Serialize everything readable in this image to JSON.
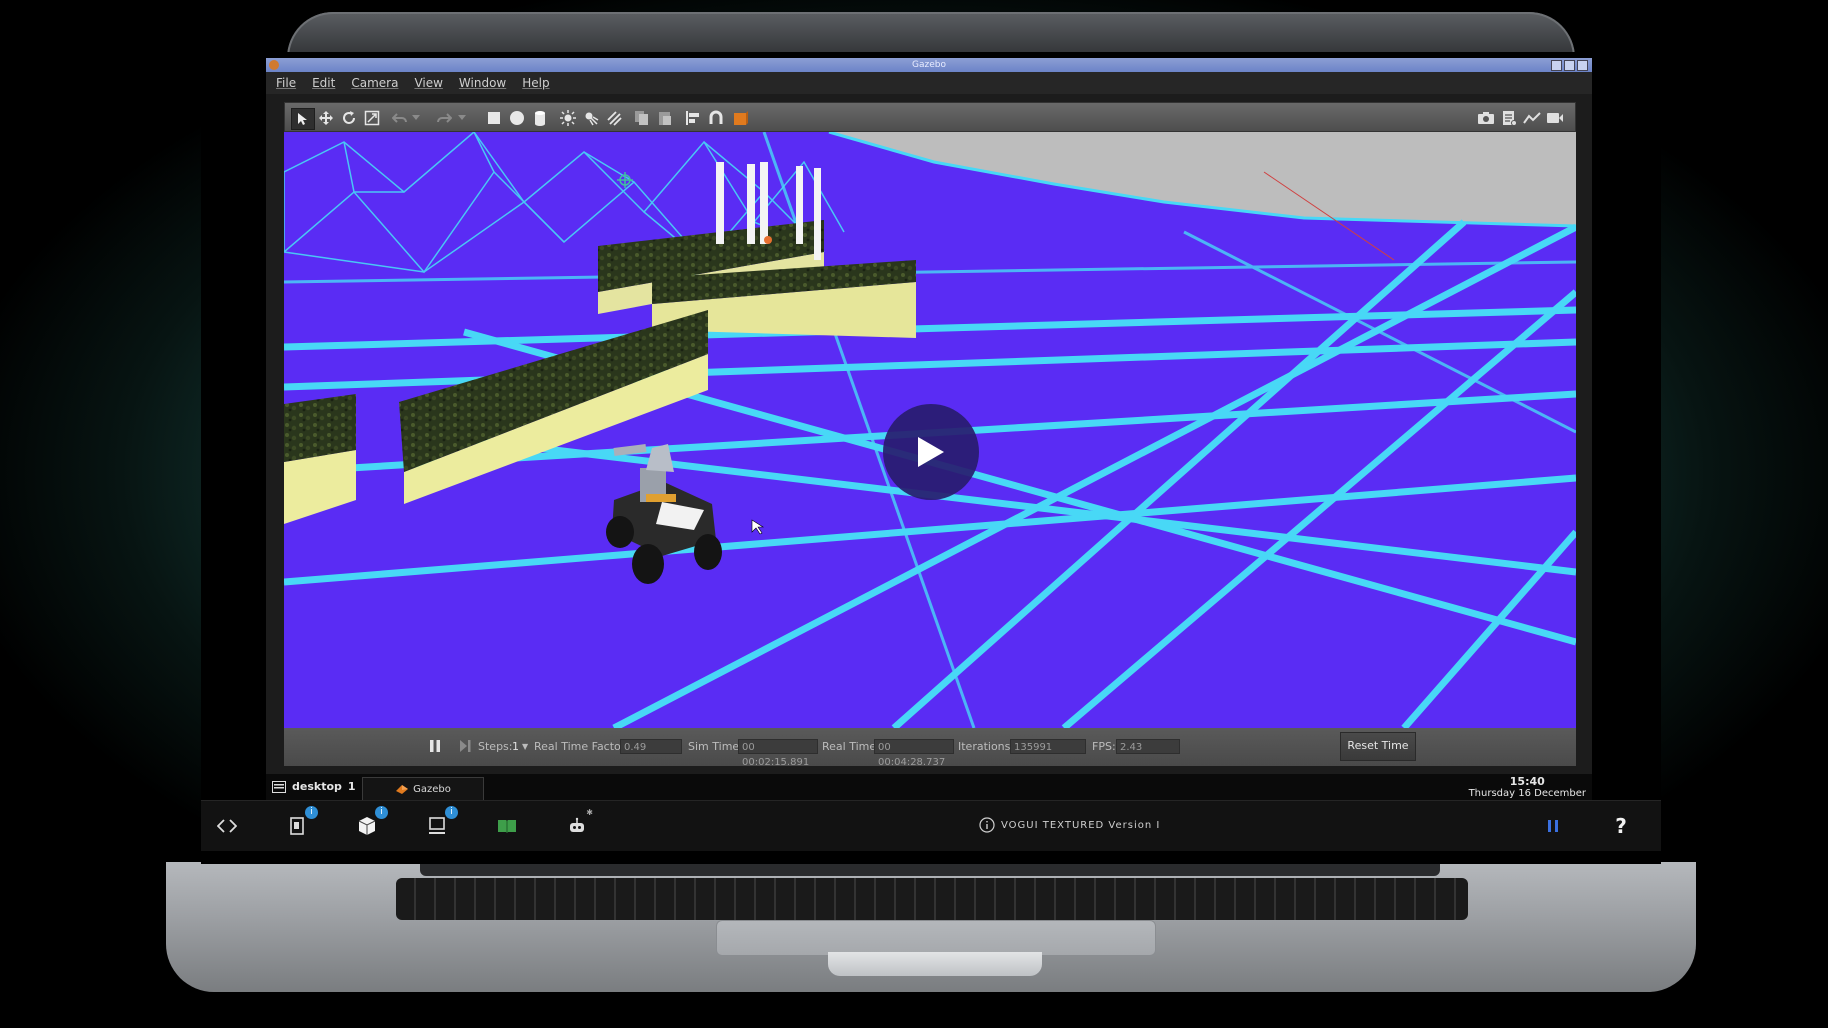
{
  "window": {
    "title": "Gazebo"
  },
  "menu": [
    "File",
    "Edit",
    "Camera",
    "View",
    "Window",
    "Help"
  ],
  "toolbar": {
    "left_icons": [
      "select-arrow-icon",
      "translate-icon",
      "rotate-icon",
      "scale-icon",
      "undo-icon",
      "undo-dropdown-icon",
      "redo-icon",
      "redo-dropdown-icon",
      "box-icon",
      "sphere-icon",
      "cylinder-icon",
      "point-light-icon",
      "spot-light-icon",
      "directional-light-icon",
      "copy-icon",
      "paste-icon",
      "align-icon",
      "snap-icon",
      "change-view-icon"
    ],
    "right_icons": [
      "screenshot-icon",
      "log-icon",
      "plot-icon",
      "video-record-icon"
    ]
  },
  "status": {
    "steps_label": "Steps:",
    "steps_value": "1",
    "rtf_label": "Real Time Factor:",
    "rtf_value": "0.49",
    "sim_time_label": "Sim Time:",
    "sim_time_value": "00 00:02:15.891",
    "real_time_label": "Real Time:",
    "real_time_value": "00 00:04:28.737",
    "iterations_label": "Iterations:",
    "iterations_value": "135991",
    "fps_label": "FPS:",
    "fps_value": "2.43",
    "reset_label": "Reset Time"
  },
  "taskbar": {
    "desktop_label": "desktop",
    "desktop_number": "1",
    "task_label": "Gazebo",
    "time": "15:40",
    "date": "Thursday 16 December"
  },
  "dock": {
    "version_text": "VOGUI TEXTURED Version I",
    "help_label": "?"
  },
  "colors": {
    "ground": "#5a2cf4",
    "grid": "#48d8f6",
    "sky": "#bdbdbd",
    "hedge": "#2e3a1e",
    "wall": "#e6e69a"
  }
}
